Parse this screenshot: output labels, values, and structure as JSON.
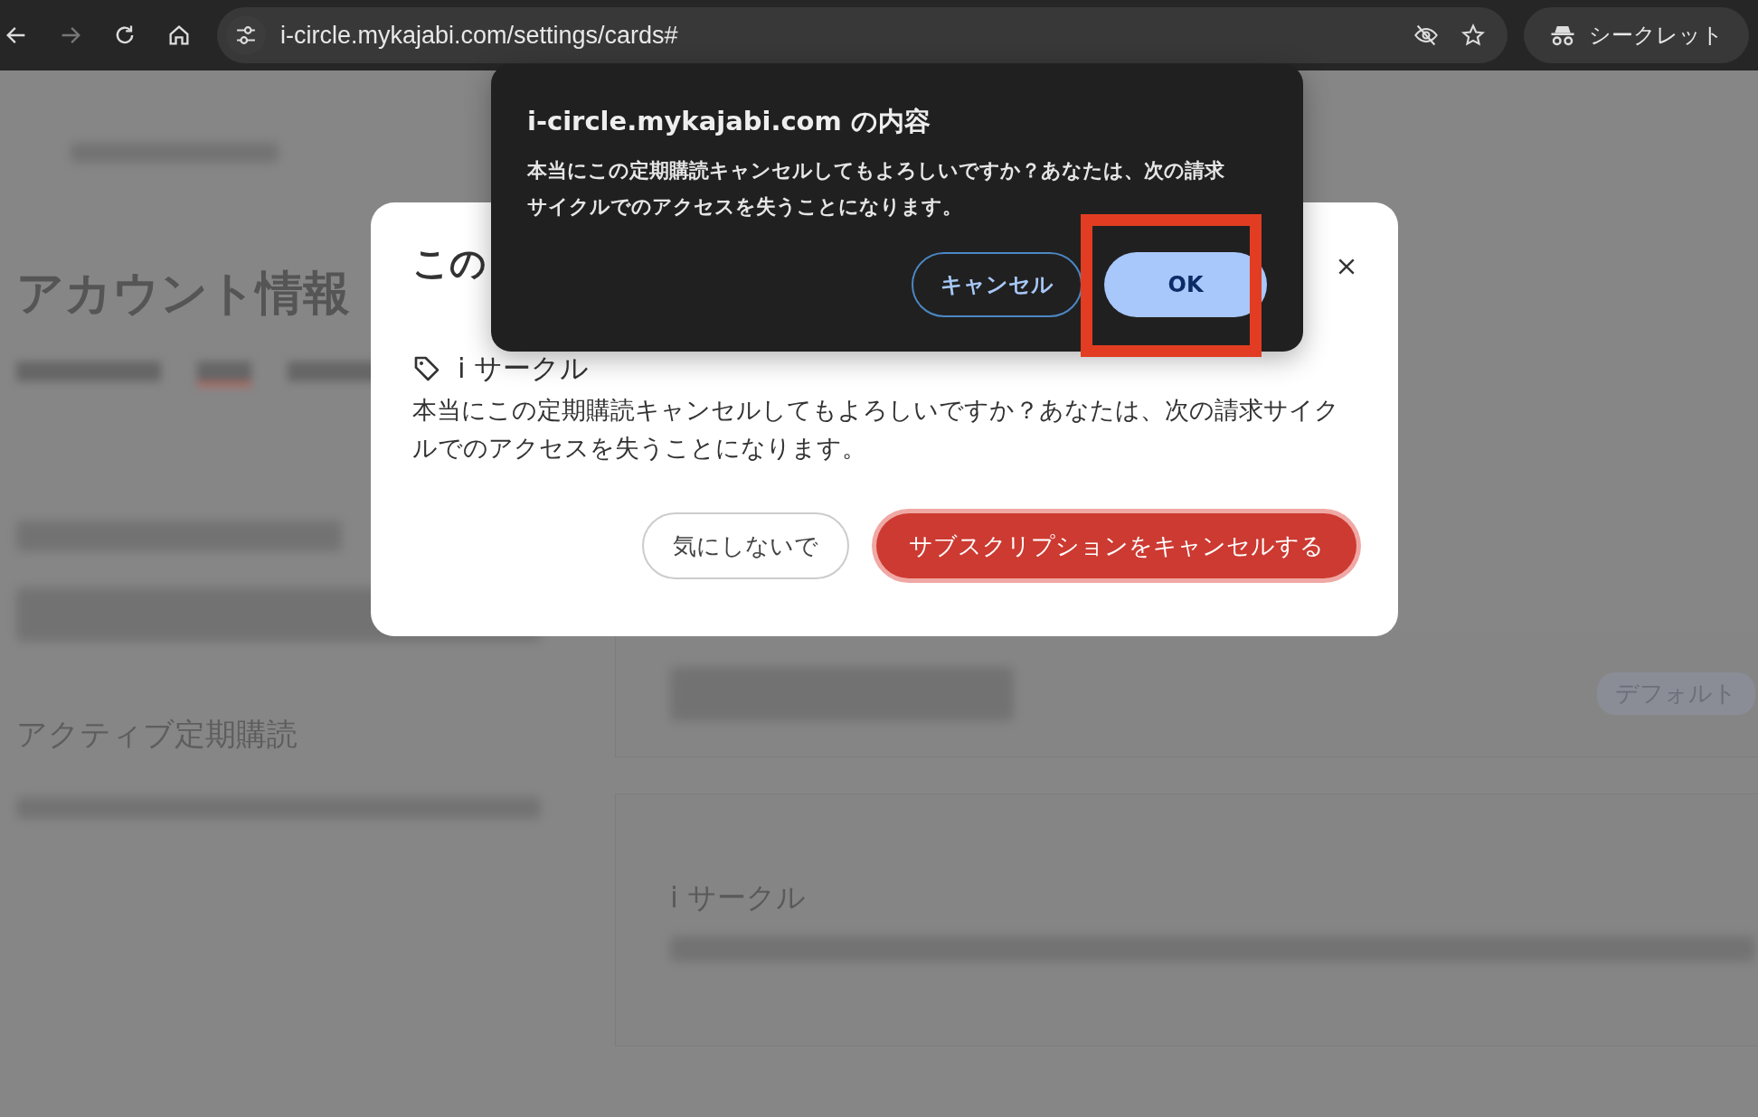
{
  "browser": {
    "url": "i-circle.mykajabi.com/settings/cards#",
    "incognito_label": "シークレット"
  },
  "page": {
    "heading": "アカウント情報",
    "badge": "デフォルト",
    "section_title": "アクティブ定期購読",
    "subscription_name": "i サークル"
  },
  "modal": {
    "title": "この",
    "tag": "i サークル",
    "message": "本当にこの定期購読キャンセルしてもよろしいですか？あなたは、次の請求サイクルでのアクセスを失うことになります。",
    "buttons": [
      {
        "label": "気にしないで",
        "kind": "secondary"
      },
      {
        "label": "サブスクリプションをキャンセルする",
        "kind": "danger"
      }
    ]
  },
  "dialog": {
    "title": "i-circle.mykajabi.com の内容",
    "message": "本当にこの定期購読キャンセルしてもよろしいですか？あなたは、次の請求サイクルでのアクセスを失うことになります。",
    "buttons": [
      {
        "label": "キャンセル",
        "kind": "outline"
      },
      {
        "label": "OK",
        "kind": "primary"
      }
    ]
  }
}
